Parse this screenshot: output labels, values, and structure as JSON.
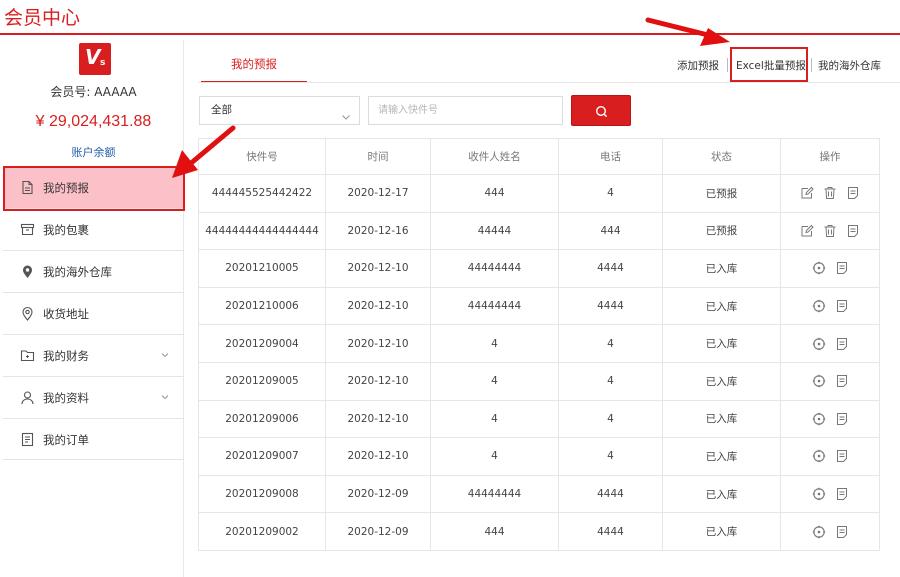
{
  "page": {
    "title": "会员中心"
  },
  "brand": {
    "logo_letter": "V",
    "logo_sub": "s",
    "accent": "#d81e1e",
    "highlight": "#fcc0c8"
  },
  "account": {
    "member_id": "会员号: AAAAA",
    "balance": "¥ 29,024,431.88",
    "balance_link": "账户余额"
  },
  "sidebar": {
    "items": [
      {
        "label": "我的预报",
        "icon": "document-icon",
        "active": true
      },
      {
        "label": "我的包裹",
        "icon": "box-icon"
      },
      {
        "label": "我的海外仓库",
        "icon": "location-icon"
      },
      {
        "label": "收货地址",
        "icon": "pin-icon"
      },
      {
        "label": "我的财务",
        "icon": "folder-icon",
        "expandable": true
      },
      {
        "label": "我的资料",
        "icon": "user-icon",
        "expandable": true
      },
      {
        "label": "我的订单",
        "icon": "list-icon"
      }
    ]
  },
  "tabs": {
    "active_label": "我的预报"
  },
  "top_links": {
    "add": "添加预报",
    "excel": "Excel批量预报",
    "warehouse": "我的海外仓库"
  },
  "filter": {
    "select_value": "全部",
    "search_placeholder": "请输入快件号"
  },
  "table": {
    "headers": [
      "快件号",
      "时间",
      "收件人姓名",
      "电话",
      "状态",
      "操作"
    ],
    "rows": [
      {
        "no": "444445525442422",
        "time": "2020-12-17",
        "name": "444",
        "phone": "4",
        "status": "已预报",
        "actions": [
          "edit",
          "delete",
          "detail"
        ]
      },
      {
        "no": "44444444444444444",
        "time": "2020-12-16",
        "name": "44444",
        "phone": "444",
        "status": "已预报",
        "actions": [
          "edit",
          "delete",
          "detail"
        ]
      },
      {
        "no": "20201210005",
        "time": "2020-12-10",
        "name": "44444444",
        "phone": "4444",
        "status": "已入库",
        "actions": [
          "locate",
          "detail"
        ]
      },
      {
        "no": "20201210006",
        "time": "2020-12-10",
        "name": "44444444",
        "phone": "4444",
        "status": "已入库",
        "actions": [
          "locate",
          "detail"
        ]
      },
      {
        "no": "20201209004",
        "time": "2020-12-10",
        "name": "4",
        "phone": "4",
        "status": "已入库",
        "actions": [
          "locate",
          "detail"
        ]
      },
      {
        "no": "20201209005",
        "time": "2020-12-10",
        "name": "4",
        "phone": "4",
        "status": "已入库",
        "actions": [
          "locate",
          "detail"
        ]
      },
      {
        "no": "20201209006",
        "time": "2020-12-10",
        "name": "4",
        "phone": "4",
        "status": "已入库",
        "actions": [
          "locate",
          "detail"
        ]
      },
      {
        "no": "20201209007",
        "time": "2020-12-10",
        "name": "4",
        "phone": "4",
        "status": "已入库",
        "actions": [
          "locate",
          "detail"
        ]
      },
      {
        "no": "20201209008",
        "time": "2020-12-09",
        "name": "44444444",
        "phone": "4444",
        "status": "已入库",
        "actions": [
          "locate",
          "detail"
        ]
      },
      {
        "no": "20201209002",
        "time": "2020-12-09",
        "name": "444",
        "phone": "4444",
        "status": "已入库",
        "actions": [
          "locate",
          "detail"
        ]
      }
    ]
  }
}
